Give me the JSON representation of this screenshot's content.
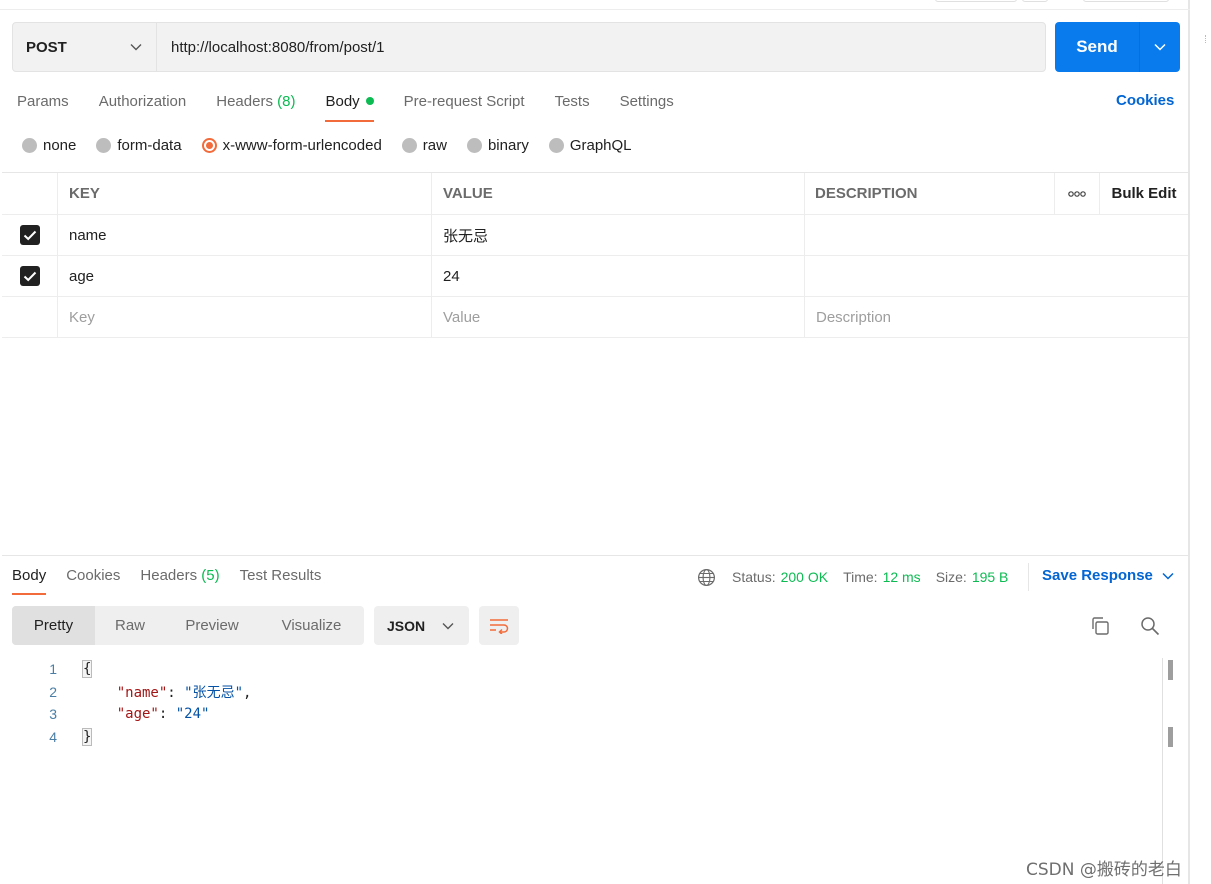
{
  "request": {
    "method": "POST",
    "url": "http://localhost:8080/from/post/1",
    "send_label": "Send"
  },
  "request_tabs": [
    {
      "label": "Params"
    },
    {
      "label": "Authorization"
    },
    {
      "label": "Headers",
      "count": "(8)"
    },
    {
      "label": "Body"
    },
    {
      "label": "Pre-request Script"
    },
    {
      "label": "Tests"
    },
    {
      "label": "Settings"
    }
  ],
  "cookies_link": "Cookies",
  "body_types": [
    {
      "label": "none"
    },
    {
      "label": "form-data"
    },
    {
      "label": "x-www-form-urlencoded",
      "selected": true
    },
    {
      "label": "raw"
    },
    {
      "label": "binary"
    },
    {
      "label": "GraphQL"
    }
  ],
  "kv_table": {
    "headers": {
      "key": "KEY",
      "value": "VALUE",
      "description": "DESCRIPTION",
      "bulk_edit": "Bulk Edit"
    },
    "rows": [
      {
        "checked": true,
        "key": "name",
        "value": "张无忌",
        "description": ""
      },
      {
        "checked": true,
        "key": "age",
        "value": "24",
        "description": ""
      }
    ],
    "placeholders": {
      "key": "Key",
      "value": "Value",
      "description": "Description"
    }
  },
  "response": {
    "tabs": [
      {
        "label": "Body"
      },
      {
        "label": "Cookies"
      },
      {
        "label": "Headers",
        "count": "(5)"
      },
      {
        "label": "Test Results"
      }
    ],
    "status_label": "Status:",
    "status_value": "200 OK",
    "time_label": "Time:",
    "time_value": "12 ms",
    "size_label": "Size:",
    "size_value": "195 B",
    "save_label": "Save Response",
    "views": [
      {
        "label": "Pretty"
      },
      {
        "label": "Raw"
      },
      {
        "label": "Preview"
      },
      {
        "label": "Visualize"
      }
    ],
    "format": "JSON",
    "code_lines": [
      "1",
      "2",
      "3",
      "4"
    ],
    "json": {
      "open": "{",
      "k1": "\"name\"",
      "v1": "\"张无忌\"",
      "k2": "\"age\"",
      "v2": "\"24\"",
      "close": "}"
    }
  },
  "watermark": "CSDN @搬砖的老白",
  "colors": {
    "accent": "#f26b3a",
    "send": "#097bed",
    "link": "#0265d2",
    "success": "#0cbb52"
  }
}
